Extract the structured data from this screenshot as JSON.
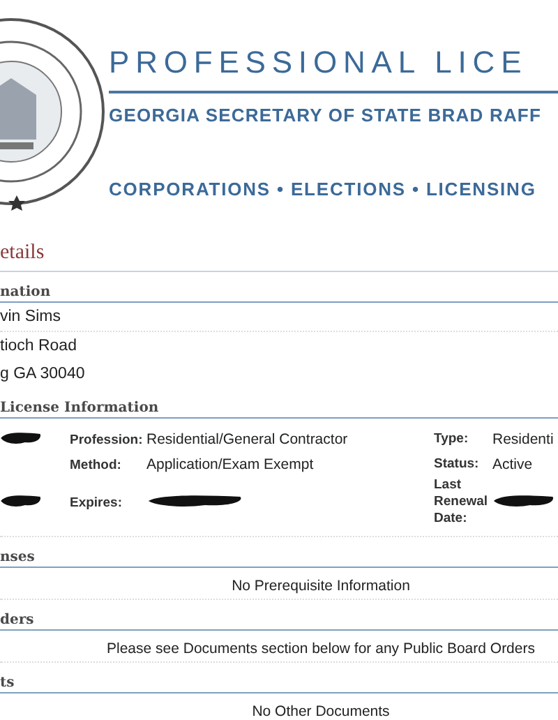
{
  "header": {
    "title": "PROFESSIONAL LICE",
    "subtitle": "GEORGIA SECRETARY OF STATE BRAD RAFF",
    "nav": "CORPORATIONS • ELECTIONS • LICENSING"
  },
  "page_title": "etails",
  "sections": [
    {
      "heading": "nation",
      "kind": "lines",
      "lines": [
        "vin Sims",
        "tioch Road",
        "g GA 30040"
      ]
    },
    {
      "heading": "License Information",
      "kind": "license",
      "rows": [
        {
          "left_redacted": true,
          "label": "Profession:",
          "value": "Residential/General Contractor",
          "value_redacted": false,
          "right_label": "Type:",
          "right_value": "Residenti",
          "right_value_redacted": false
        },
        {
          "left_redacted": false,
          "label": "Method:",
          "value": "Application/Exam Exempt",
          "value_redacted": false,
          "right_label": "Status:",
          "right_value": "Active",
          "right_value_redacted": false
        },
        {
          "left_redacted": true,
          "label": "Expires:",
          "value_redacted": true,
          "right_label": "Last Renewal Date:",
          "right_value_redacted": true
        }
      ]
    },
    {
      "heading": "nses",
      "kind": "message",
      "message": "No Prerequisite Information"
    },
    {
      "heading": "ders",
      "kind": "message",
      "message": "Please see Documents section below for any Public Board Orders"
    },
    {
      "heading": "ts",
      "kind": "message",
      "message": "No Other Documents"
    }
  ]
}
